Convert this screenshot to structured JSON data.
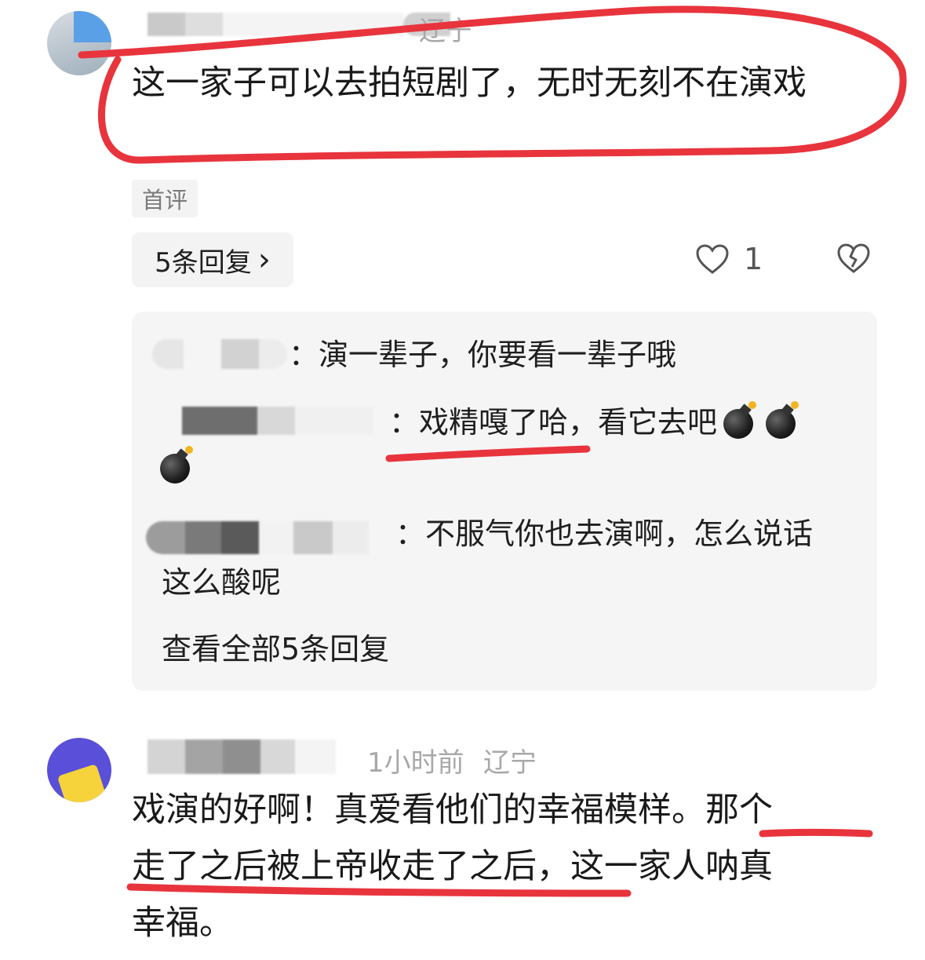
{
  "comments": [
    {
      "location": "辽宁",
      "text": "这一家子可以去拍短剧了，无时无刻不在演戏",
      "badge": "首评",
      "replies_button": "5条回复",
      "replies_chevron": "›",
      "likes": "1",
      "replies": [
        {
          "text": "：演一辈子，你要看一辈子哦"
        },
        {
          "text": "：戏精嘎了哈，看它去吧",
          "emoji": [
            "bomb-icon",
            "bomb-icon",
            "bomb-icon"
          ]
        },
        {
          "text_line1": "：不服气你也去演啊，怎么说话",
          "text_line2": "这么酸呢"
        }
      ],
      "view_all": "查看全部5条回复"
    },
    {
      "time": "1小时前",
      "location": "辽宁",
      "text_line1": "戏演的好啊！真爱看他们的幸福模样。那个",
      "text_line2": "走了之后被上帝收走了之后，这一家人呐真",
      "text_line3": "幸福。"
    }
  ],
  "colors": {
    "annotation_red": "#e8343c",
    "reply_panel_bg": "#f5f5f5",
    "meta_gray": "#a8a8a8"
  }
}
